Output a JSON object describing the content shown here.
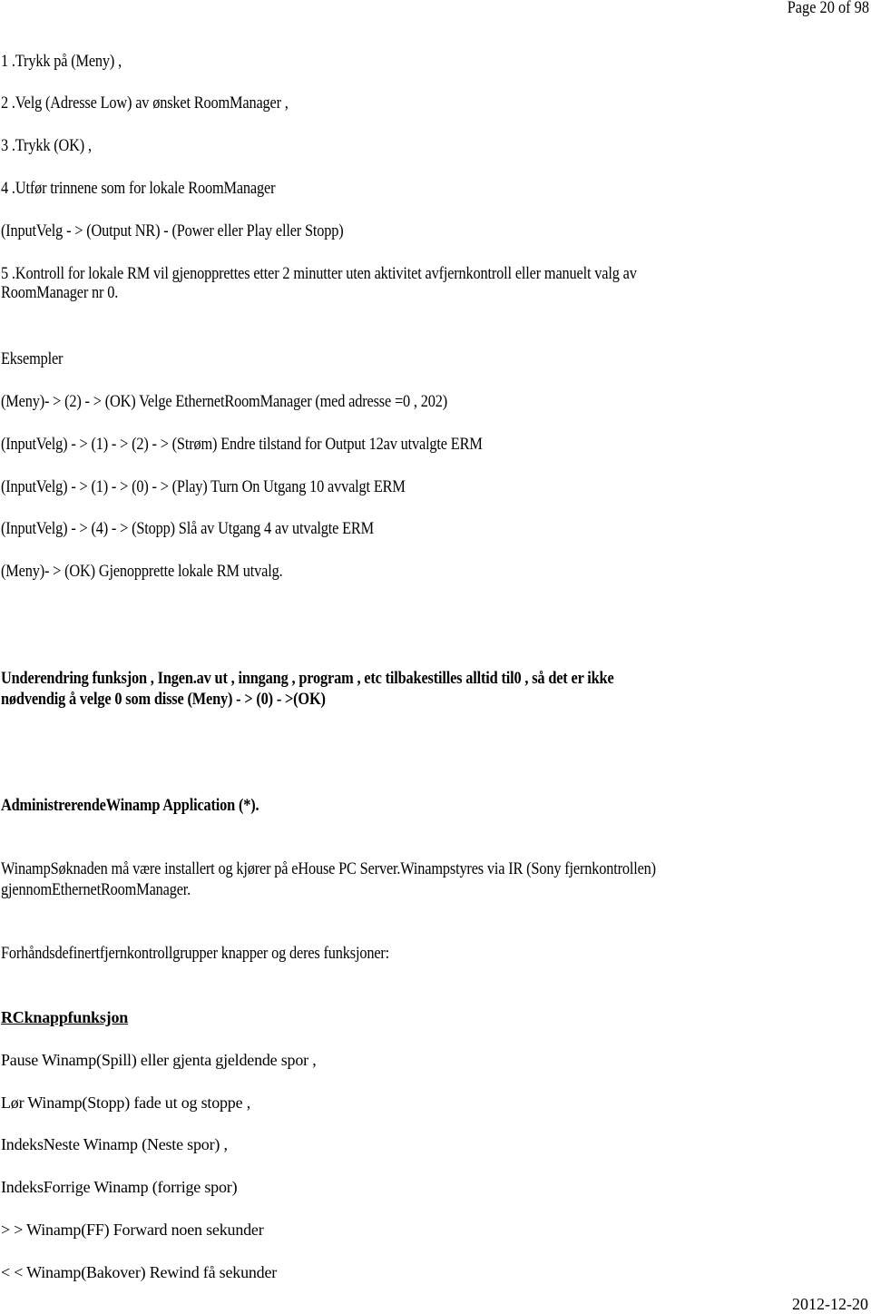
{
  "header": {
    "page_number": "Page 20 of 98"
  },
  "steps": [
    "1 .Trykk på (Meny) ,",
    "2 .Velg (Adresse Low) av ønsket RoomManager ,",
    "3 .Trykk (OK) ,",
    "4 .Utfør trinnene som for lokale RoomManager",
    "(InputVelg - > (Output NR) - (Power eller Play eller Stopp)"
  ],
  "step5": {
    "line1": "5 .Kontroll for lokale RM vil gjenopprettes etter 2 minutter uten aktivitet avfjernkontroll eller manuelt valg av",
    "line2": "RoomManager nr 0."
  },
  "examples": {
    "heading": "Eksempler",
    "items": [
      "(Meny)- > (2) - > (OK) Velge EthernetRoomManager (med adresse =0 , 202)",
      "(InputVelg) - > (1) - > (2) - > (Strøm) Endre tilstand for Output 12av utvalgte ERM",
      "(InputVelg) - > (1) - > (0) - > (Play) Turn On Utgang 10 avvalgt ERM",
      "(InputVelg) - > (4) - > (Stopp) Slå av Utgang 4 av utvalgte ERM",
      "(Meny)- > (OK) Gjenopprette lokale RM utvalg."
    ]
  },
  "note": {
    "line1": "Underendring funksjon , Ingen.av ut , inngang , program , etc tilbakestilles alltid til0 , så det er ikke",
    "line2": "nødvendig å velge 0 som disse (Meny) - > (0) - >(OK)"
  },
  "winamp": {
    "heading": "AdministrerendeWinamp Application (*).",
    "description_line1": "WinampSøknaden må være installert og kjører på eHouse PC Server.Winampstyres via IR (Sony fjernkontrollen)",
    "description_line2": "gjennomEthernetRoomManager.",
    "groups_intro": "Forhåndsdefinertfjernkontrollgrupper knapper og deres funksjoner:"
  },
  "rc_functions": {
    "heading": "RCknappfunksjon",
    "items": [
      "Pause Winamp(Spill) eller gjenta gjeldende spor ,",
      "Lør Winamp(Stopp) fade ut og stoppe ,",
      "IndeksNeste Winamp (Neste spor) ,",
      "IndeksForrige Winamp (forrige spor)",
      "> > Winamp(FF) Forward noen sekunder",
      "< < Winamp(Bakover) Rewind få sekunder"
    ]
  },
  "footer": {
    "date": "2012-12-20"
  }
}
